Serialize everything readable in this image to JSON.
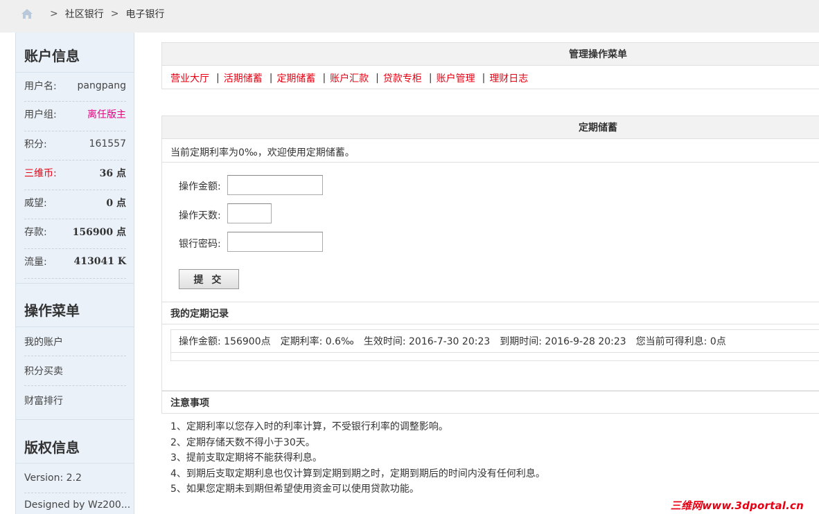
{
  "breadcrumb": {
    "home_icon": "home-icon",
    "separator": ">",
    "items": [
      "社区银行",
      "电子银行"
    ]
  },
  "sidebar": {
    "account_title": "账户信息",
    "account_rows": [
      {
        "key": "用户名:",
        "value": "pangpang"
      },
      {
        "key": "用户组:",
        "value": "离任版主"
      },
      {
        "key": "积分:",
        "value": "161557"
      },
      {
        "key": "三维币:",
        "value": "36 点"
      },
      {
        "key": "威望:",
        "value": "0 点"
      },
      {
        "key": "存款:",
        "value": "156900 点"
      },
      {
        "key": "流量:",
        "value": "413041 K"
      }
    ],
    "menu_title": "操作菜单",
    "menu_items": [
      "我的账户",
      "积分买卖",
      "财富排行"
    ],
    "copyright_title": "版权信息",
    "version": "Version: 2.2",
    "designed_by": "Designed by Wz200..."
  },
  "manage_menu": {
    "title": "管理操作菜单",
    "links": [
      "营业大厅",
      "活期储蓄",
      "定期储蓄",
      "账户汇款",
      "贷款专柜",
      "账户管理",
      "理财日志"
    ],
    "separator": "|"
  },
  "fixed_deposit": {
    "title": "定期储蓄",
    "notice": "当前定期利率为0‰，欢迎使用定期储蓄。",
    "form": {
      "amount_label": "操作金额:",
      "amount_value": "",
      "days_label": "操作天数:",
      "days_value": "",
      "password_label": "银行密码:",
      "password_value": "",
      "submit_label": "提 交"
    }
  },
  "records": {
    "title": "我的定期记录",
    "row": {
      "amount": "操作金额: 156900点",
      "rate": "定期利率: 0.6‰",
      "start": "生效时间: 2016-7-30 20:23",
      "end": "到期时间: 2016-9-28 20:23",
      "interest": "您当前可得利息: 0点"
    }
  },
  "notes": {
    "title": "注意事项",
    "items": [
      "1、定期利率以您存入时的利率计算，不受银行利率的调整影响。",
      "2、定期存储天数不得小于30天。",
      "3、提前支取定期将不能获得利息。",
      "4、到期后支取定期利息也仅计算到定期到期之时，定期到期后的时间内没有任何利息。",
      "5、如果您定期未到期但希望使用资金可以使用贷款功能。"
    ]
  },
  "watermark": "三维网www.3dportal.cn",
  "colors": {
    "link_red": "#e60012",
    "group_pink": "#e4007f",
    "sidebar_bg": "#eaf1f9",
    "topbar_bg": "#efefef"
  }
}
